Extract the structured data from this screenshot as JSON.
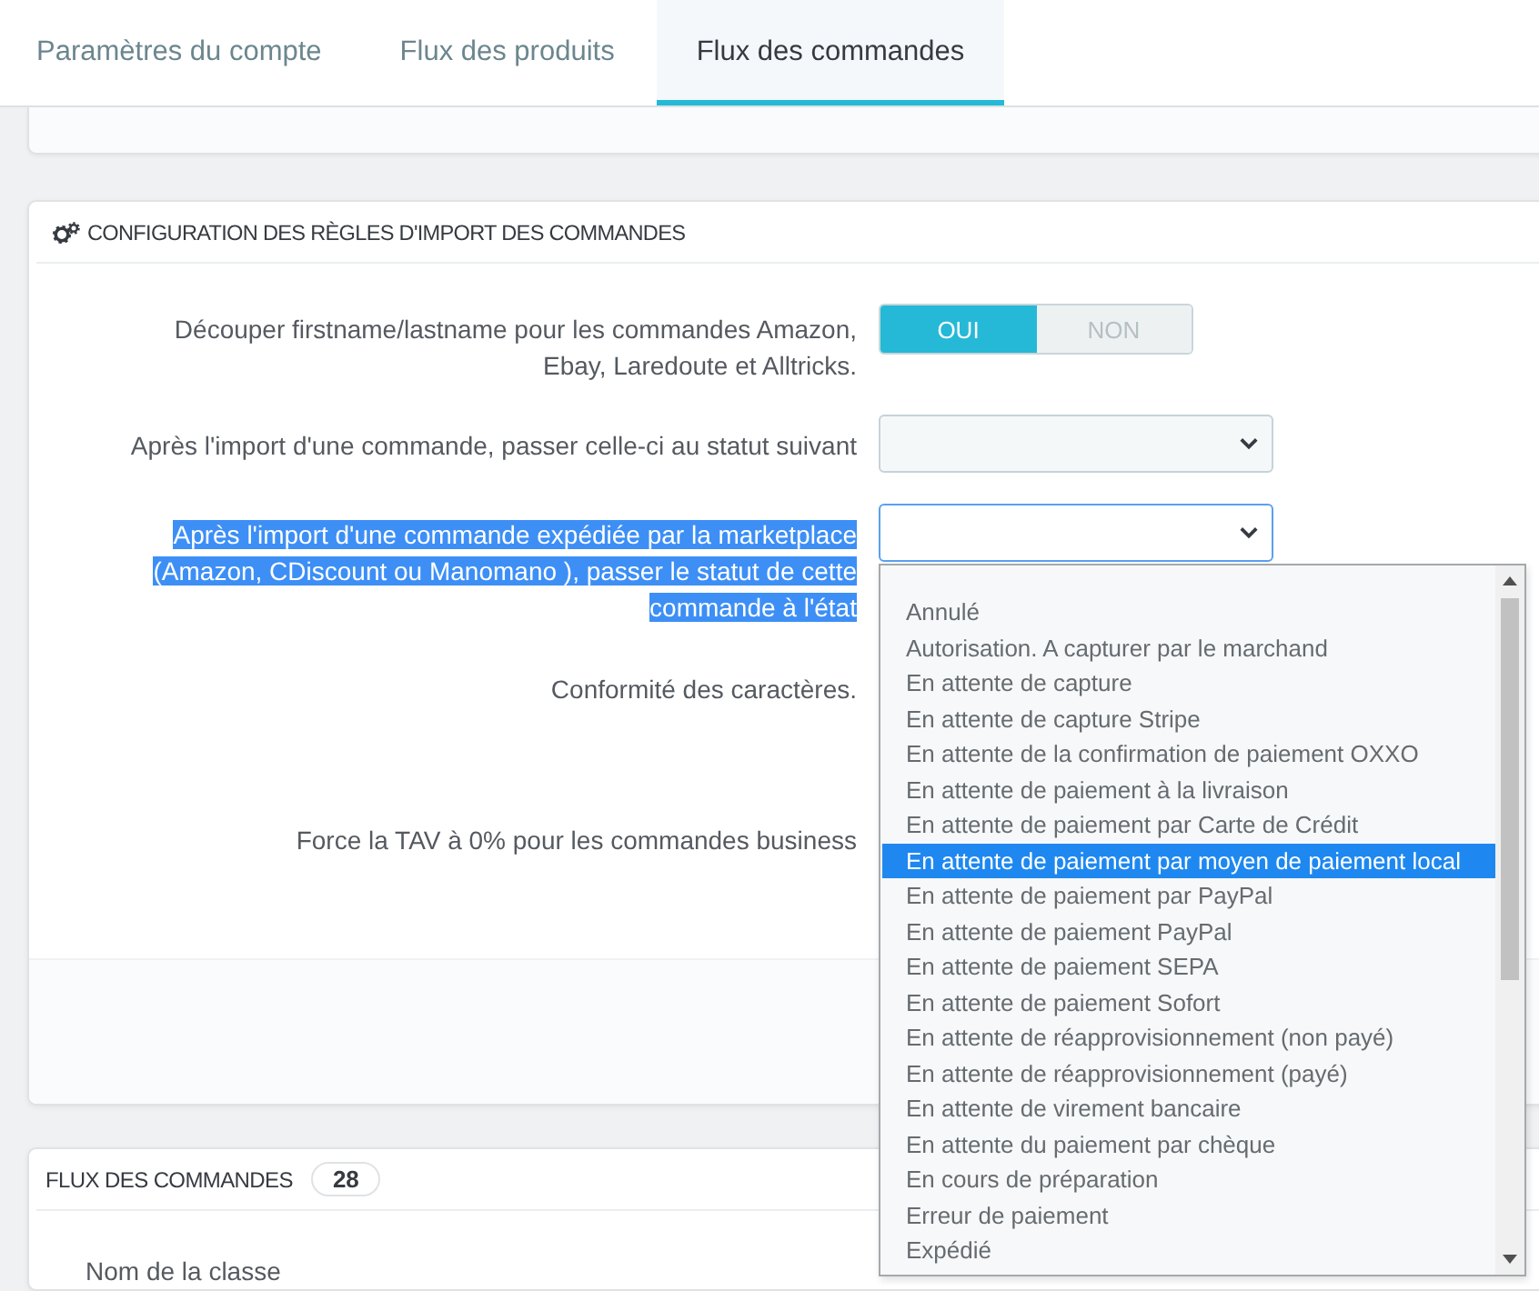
{
  "tabs": [
    {
      "label": "Paramètres du compte",
      "selected": false
    },
    {
      "label": "Flux des produits",
      "selected": false
    },
    {
      "label": "Flux des commandes",
      "selected": true
    }
  ],
  "import_rules_panel": {
    "title": "CONFIGURATION DES RÈGLES D'IMPORT DES COMMANDES",
    "rows": [
      {
        "kind": "switch",
        "label": "Découper firstname/lastname pour les commandes Amazon, Ebay, Laredoute et Alltricks.",
        "highlighted": false,
        "options": [
          {
            "label": "OUI",
            "selected": true
          },
          {
            "label": "NON",
            "selected": false
          }
        ]
      },
      {
        "kind": "select",
        "label": "Après l'import d'une commande, passer celle-ci au statut suivant",
        "highlighted": false,
        "focused": false
      },
      {
        "kind": "select",
        "label": "Après l'import d'une commande expédiée par la marketplace (Amazon, CDiscount ou Manomano ), passer le statut de cette commande à l'état",
        "highlighted": true,
        "focused": true,
        "dropdown": {
          "options": [
            {
              "label": "Annulé",
              "selected": false
            },
            {
              "label": "Autorisation. A capturer par le marchand",
              "selected": false
            },
            {
              "label": "En attente de capture",
              "selected": false
            },
            {
              "label": "En attente de capture Stripe",
              "selected": false
            },
            {
              "label": "En attente de la confirmation de paiement OXXO",
              "selected": false
            },
            {
              "label": "En attente de paiement à la livraison",
              "selected": false
            },
            {
              "label": "En attente de paiement par Carte de Crédit",
              "selected": false
            },
            {
              "label": "En attente de paiement par moyen de paiement local",
              "selected": true
            },
            {
              "label": "En attente de paiement par PayPal",
              "selected": false
            },
            {
              "label": "En attente de paiement PayPal",
              "selected": false
            },
            {
              "label": "En attente de paiement SEPA",
              "selected": false
            },
            {
              "label": "En attente de paiement Sofort",
              "selected": false
            },
            {
              "label": "En attente de réapprovisionnement (non payé)",
              "selected": false
            },
            {
              "label": "En attente de réapprovisionnement (payé)",
              "selected": false
            },
            {
              "label": "En attente de virement bancaire",
              "selected": false
            },
            {
              "label": "En attente du paiement par chèque",
              "selected": false
            },
            {
              "label": "En cours de préparation",
              "selected": false
            },
            {
              "label": "Erreur de paiement",
              "selected": false
            },
            {
              "label": "Expédié",
              "selected": false
            }
          ]
        }
      },
      {
        "kind": "label",
        "label": "Conformité des caractères.",
        "highlighted": false
      },
      {
        "kind": "label",
        "label": "Force la TAV à 0% pour les commandes business",
        "highlighted": false
      }
    ]
  },
  "orders_feed_panel": {
    "title": "FLUX DES COMMANDES",
    "count": "28",
    "columns": [
      "Nom de la classe"
    ]
  }
}
